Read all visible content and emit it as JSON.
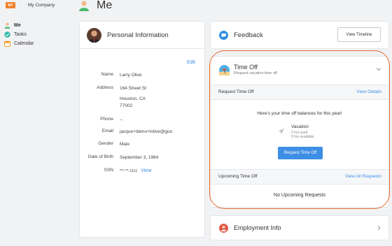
{
  "company": {
    "logo": "MY",
    "name": "My Company"
  },
  "nav": [
    {
      "label": "Me",
      "icon": "person-icon",
      "active": true
    },
    {
      "label": "Tasks",
      "icon": "check-circle-icon",
      "active": false
    },
    {
      "label": "Calendar",
      "icon": "calendar-icon",
      "active": false
    }
  ],
  "page": {
    "title": "Me"
  },
  "personal": {
    "title": "Personal Information",
    "edit": "Edit",
    "fields": {
      "name": {
        "label": "Name",
        "value": "Larry Olive"
      },
      "address": {
        "label": "Address",
        "line1": "164 Street St",
        "line2": "Houston, CA",
        "line3": "77002"
      },
      "phone": {
        "label": "Phone",
        "value": "--"
      },
      "email": {
        "label": "Email",
        "value": "jacque+demo+lolive@goo"
      },
      "gender": {
        "label": "Gender",
        "value": "Male"
      },
      "dob": {
        "label": "Date of Birth",
        "value": "September 3, 1964"
      },
      "ssn": {
        "label": "SSN",
        "value": "***-**-1111",
        "link": "View"
      }
    }
  },
  "feedback": {
    "title": "Feedback",
    "button": "View Timeline"
  },
  "timeoff": {
    "title": "Time Off",
    "subtitle": "Request vacation time off",
    "request_header": "Request Time Off",
    "view_details": "View Details",
    "balances_text": "Here's your time off balances for this year!",
    "vacation": {
      "name": "Vacation",
      "used": "0 hrs used",
      "available": "0 hrs available"
    },
    "request_button": "Request Time Off",
    "upcoming_header": "Upcoming Time Off",
    "view_all": "View All Requests",
    "no_upcoming": "No Upcoming Requests"
  },
  "employment": {
    "title": "Employment Info"
  },
  "colors": {
    "accent": "#3e8ee5",
    "brand": "#f4802a",
    "highlight": "#e76a2e"
  }
}
